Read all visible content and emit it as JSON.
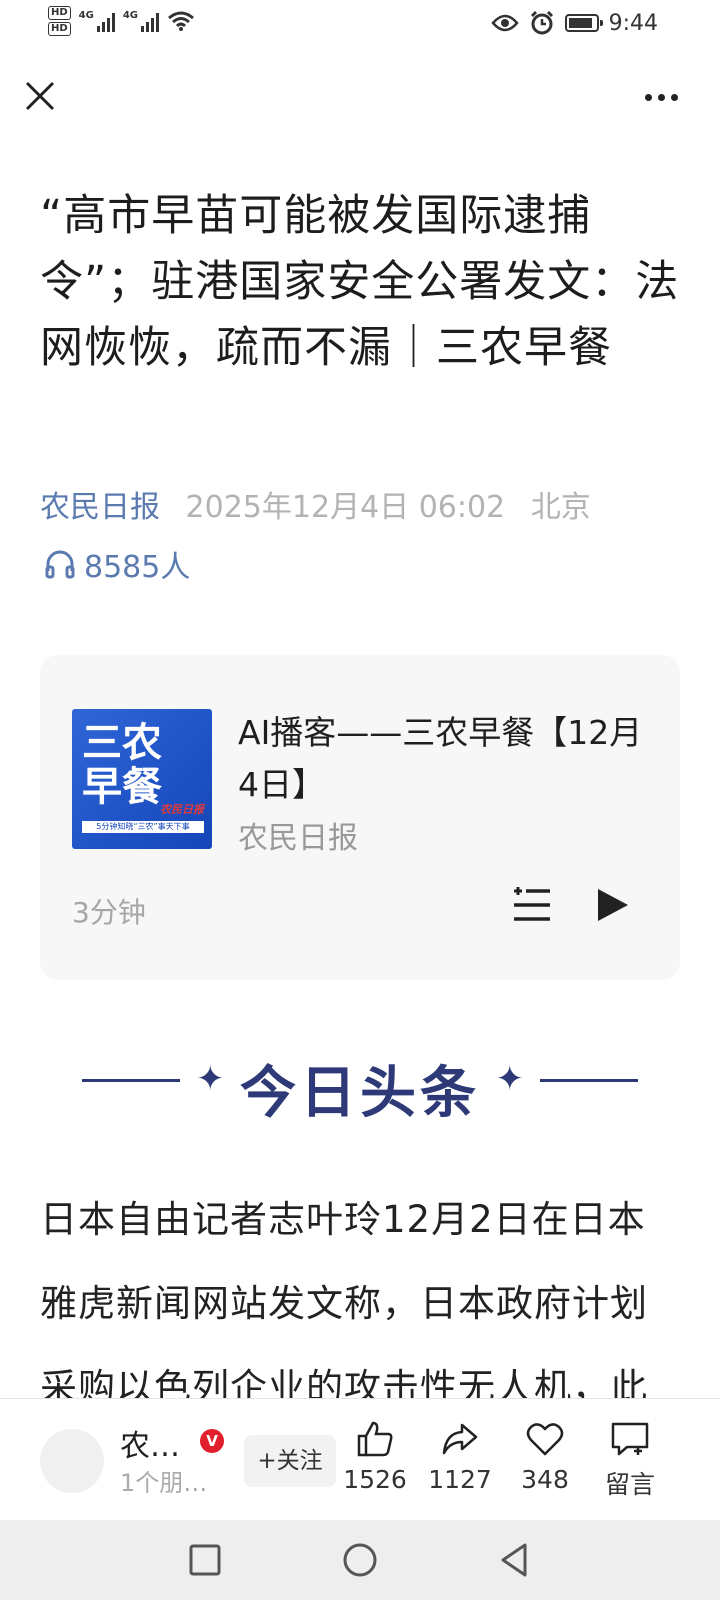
{
  "status_bar": {
    "time": "9:44",
    "network_1": "4G",
    "network_2": "4G",
    "hd_1": "HD",
    "hd_2": "HD",
    "battery_level": 0.9
  },
  "article": {
    "title": "“高市早苗可能被发国际逮捕令”；驻港国家安全公署发文：法网恢恢，疏而不漏｜三农早餐",
    "source": "农民日报",
    "datetime": "2025年12月4日 06:02",
    "location": "北京",
    "listeners": "8585人"
  },
  "podcast": {
    "cover_line1": "三农",
    "cover_line2": "早餐",
    "cover_seal": "农民日报",
    "cover_sub": "5分钟知晓“三农”事天下事",
    "title": "AI播客——三农早餐【12月4日】",
    "source": "农民日报",
    "duration": "3分钟"
  },
  "section": {
    "heading": "今日头条",
    "star": "✦"
  },
  "body_text": "日本自由记者志叶玲12月2日在日本雅虎新闻网站发文称，日本政府计划采购以色列企业的攻击性无人机，此",
  "bottom_bar": {
    "account_name": "农…",
    "account_badge": "V",
    "account_sub": "1个朋…",
    "follow_label": "+关注",
    "likes": "1526",
    "shares": "1127",
    "favorites": "348",
    "comment_label": "留言"
  },
  "colors": {
    "accent_blue": "#5b7bb0",
    "section_navy": "#2d3a77",
    "badge_red": "#e0202a"
  },
  "icons": {
    "close": "close-icon",
    "more": "more-icon",
    "headphones": "headphones-icon",
    "playlist": "playlist-icon",
    "play": "play-icon",
    "like": "thumbs-up-icon",
    "share": "share-icon",
    "favorite": "heart-icon",
    "comment": "comment-icon",
    "nav_recent": "square-nav-icon",
    "nav_home": "circle-nav-icon",
    "nav_back": "triangle-back-icon"
  }
}
